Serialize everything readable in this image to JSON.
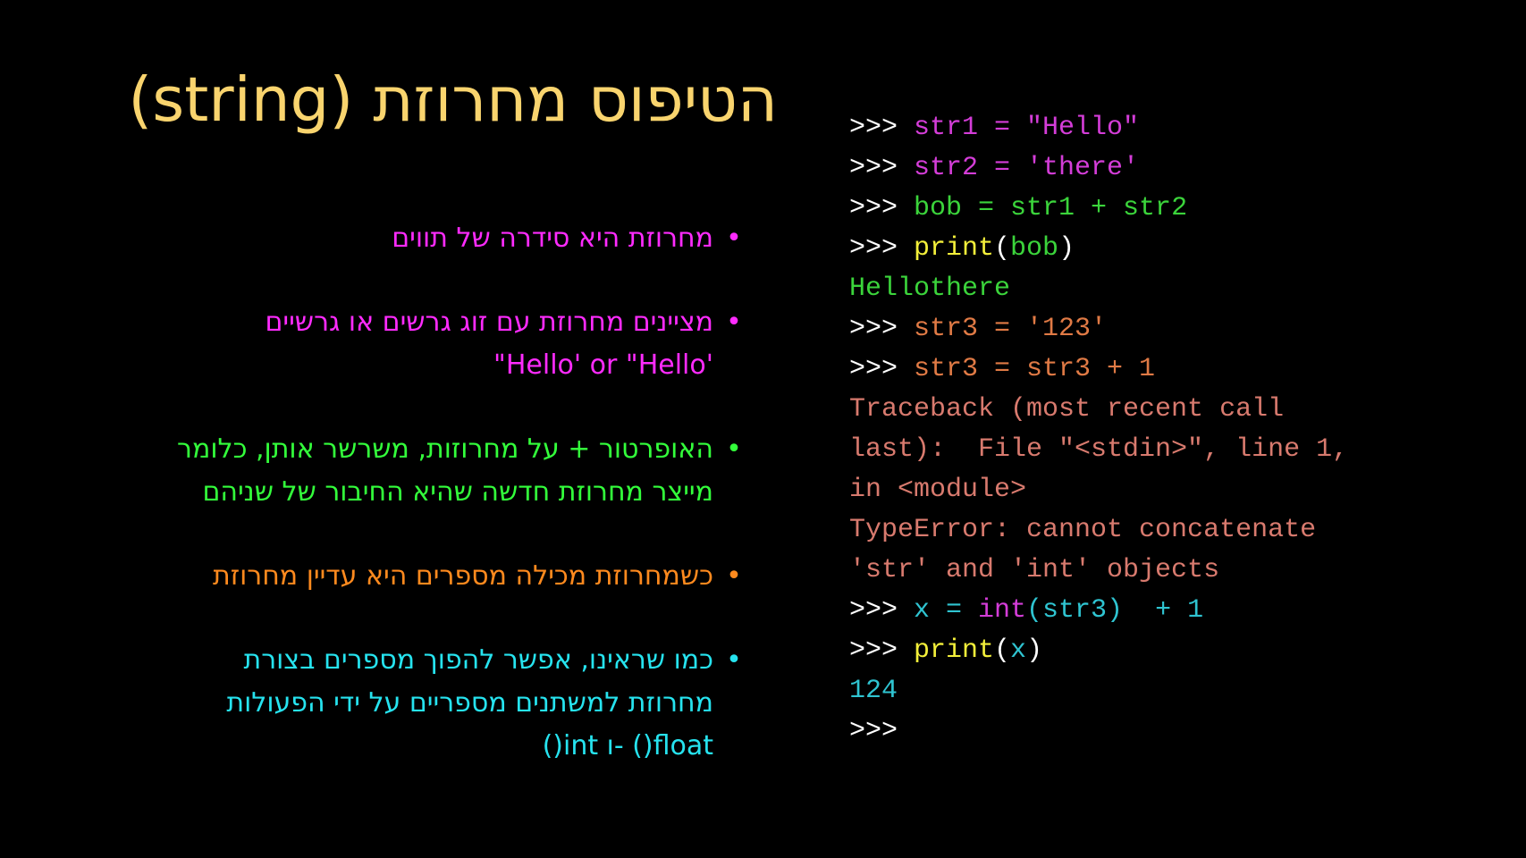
{
  "slide": {
    "title": "הטיפוס מחרוזת  (string)",
    "bullet_symbol": "•",
    "bullets": [
      {
        "lines": [
          "מחרוזת היא סידרה של תווים"
        ],
        "color": "#ff2bff"
      },
      {
        "lines": [
          "מציינים מחרוזת עם זוג גרשים או גרשיים",
          "'Hello' or \"Hello\""
        ],
        "color": "#ff2bff"
      },
      {
        "lines": [
          "האופרטור + על מחרוזות, משרשר אותן, כלומר",
          "מייצר מחרוזת חדשה שהיא החיבור של שניהם"
        ],
        "color": "#33ff3b"
      },
      {
        "lines": [
          "כשמחרוזת מכילה מספרים היא עדיין מחרוזת"
        ],
        "color": "#ff8a1e"
      },
      {
        "lines": [
          "כמו שראינו, אפשר להפוך מספרים בצורת",
          "מחרוזת למשתנים מספריים על ידי הפעולות",
          "float() -ו int()"
        ],
        "color": "#26e3ef"
      }
    ]
  },
  "code": {
    "prompt": ">>>",
    "lines": [
      {
        "prompt": ">>> ",
        "segments": [
          {
            "text": "str1 = \"Hello\"",
            "color": "#d43dd8"
          }
        ]
      },
      {
        "prompt": ">>> ",
        "segments": [
          {
            "text": "str2 = 'there'",
            "color": "#d43dd8"
          }
        ]
      },
      {
        "prompt": ">>> ",
        "segments": [
          {
            "text": "bob = str1 + str2",
            "color": "#3bd43b"
          }
        ]
      },
      {
        "prompt": ">>> ",
        "segments": [
          {
            "text": "print",
            "color": "#f3ef3a"
          },
          {
            "text": "(",
            "color": "#ffffff"
          },
          {
            "text": "bob",
            "color": "#3bd43b"
          },
          {
            "text": ")",
            "color": "#ffffff"
          }
        ]
      },
      {
        "prompt": "",
        "segments": [
          {
            "text": "Hellothere",
            "color": "#3bd43b"
          }
        ]
      },
      {
        "prompt": ">>> ",
        "segments": [
          {
            "text": "str3 = '123'",
            "color": "#e07a45"
          }
        ]
      },
      {
        "prompt": ">>> ",
        "segments": [
          {
            "text": "str3 = str3 + 1",
            "color": "#e07a45"
          }
        ]
      },
      {
        "prompt": "",
        "segments": [
          {
            "text": "Traceback (most recent call",
            "color": "#d87a6e"
          }
        ]
      },
      {
        "prompt": "",
        "segments": [
          {
            "text": "last):  File \"<stdin>\", line 1,",
            "color": "#d87a6e"
          }
        ]
      },
      {
        "prompt": "",
        "segments": [
          {
            "text": "in <module>",
            "color": "#d87a6e"
          }
        ]
      },
      {
        "prompt": "",
        "segments": [
          {
            "text": "TypeError: cannot concatenate",
            "color": "#d87a6e"
          }
        ]
      },
      {
        "prompt": "",
        "segments": [
          {
            "text": "'str' and 'int' objects",
            "color": "#d87a6e"
          }
        ]
      },
      {
        "prompt": ">>> ",
        "segments": [
          {
            "text": "x = ",
            "color": "#2fc4d1"
          },
          {
            "text": "int",
            "color": "#d43dd8"
          },
          {
            "text": "(str3)  + 1",
            "color": "#2fc4d1"
          }
        ]
      },
      {
        "prompt": ">>> ",
        "segments": [
          {
            "text": "print",
            "color": "#f3ef3a"
          },
          {
            "text": "(",
            "color": "#ffffff"
          },
          {
            "text": "x",
            "color": "#2fc4d1"
          },
          {
            "text": ")",
            "color": "#ffffff"
          }
        ]
      },
      {
        "prompt": "",
        "segments": [
          {
            "text": "124",
            "color": "#2fc4d1"
          }
        ]
      },
      {
        "prompt": ">>>",
        "segments": []
      }
    ]
  }
}
